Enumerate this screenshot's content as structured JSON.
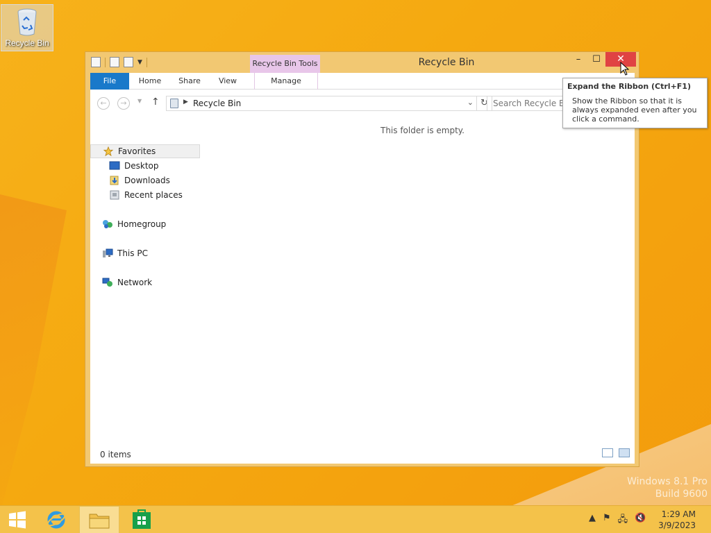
{
  "desktop": {
    "icon_label": "Recycle Bin",
    "watermark_line1": "Windows 8.1 Pro",
    "watermark_line2": "Build 9600"
  },
  "window": {
    "title": "Recycle Bin",
    "contextual_tab": "Recycle Bin Tools",
    "tabs": {
      "file": "File",
      "home": "Home",
      "share": "Share",
      "view": "View",
      "manage": "Manage"
    },
    "address": {
      "crumb": "Recycle Bin",
      "search_placeholder": "Search Recycle Bin"
    },
    "nav": {
      "favorites": "Favorites",
      "desktop": "Desktop",
      "downloads": "Downloads",
      "recent": "Recent places",
      "homegroup": "Homegroup",
      "thispc": "This PC",
      "network": "Network"
    },
    "empty_message": "This folder is empty.",
    "status": "0 items",
    "close_glyph": "✕"
  },
  "tooltip": {
    "title": "Expand the Ribbon (Ctrl+F1)",
    "body": "Show the Ribbon so that it is always expanded even after you click a command."
  },
  "clock": {
    "time": "1:29 AM",
    "date": "3/9/2023"
  }
}
